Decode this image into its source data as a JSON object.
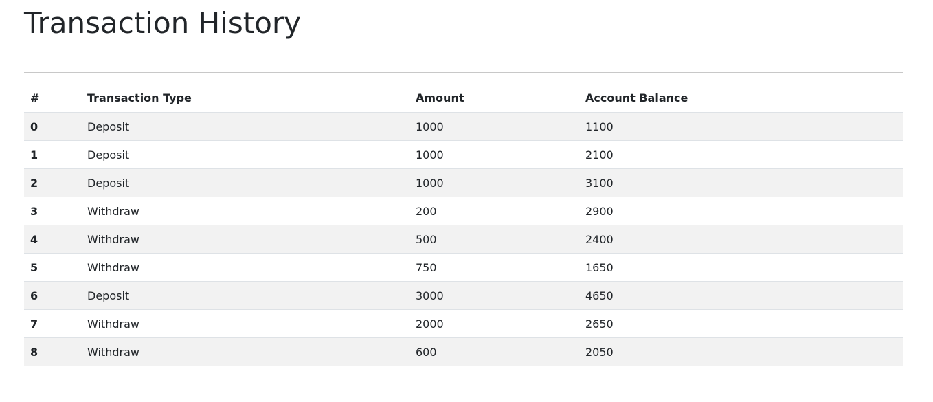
{
  "page": {
    "title": "Transaction History"
  },
  "table": {
    "columns": [
      "#",
      "Transaction Type",
      "Amount",
      "Account Balance"
    ],
    "rows": [
      {
        "index": "0",
        "type": "Deposit",
        "amount": "1000",
        "balance": "1100"
      },
      {
        "index": "1",
        "type": "Deposit",
        "amount": "1000",
        "balance": "2100"
      },
      {
        "index": "2",
        "type": "Deposit",
        "amount": "1000",
        "balance": "3100"
      },
      {
        "index": "3",
        "type": "Withdraw",
        "amount": "200",
        "balance": "2900"
      },
      {
        "index": "4",
        "type": "Withdraw",
        "amount": "500",
        "balance": "2400"
      },
      {
        "index": "5",
        "type": "Withdraw",
        "amount": "750",
        "balance": "1650"
      },
      {
        "index": "6",
        "type": "Deposit",
        "amount": "3000",
        "balance": "4650"
      },
      {
        "index": "7",
        "type": "Withdraw",
        "amount": "2000",
        "balance": "2650"
      },
      {
        "index": "8",
        "type": "Withdraw",
        "amount": "600",
        "balance": "2050"
      }
    ]
  },
  "colors": {
    "text": "#212529",
    "stripe": "#f2f2f2",
    "row_border": "#dee2e6",
    "divider": "#c8c8c8"
  }
}
